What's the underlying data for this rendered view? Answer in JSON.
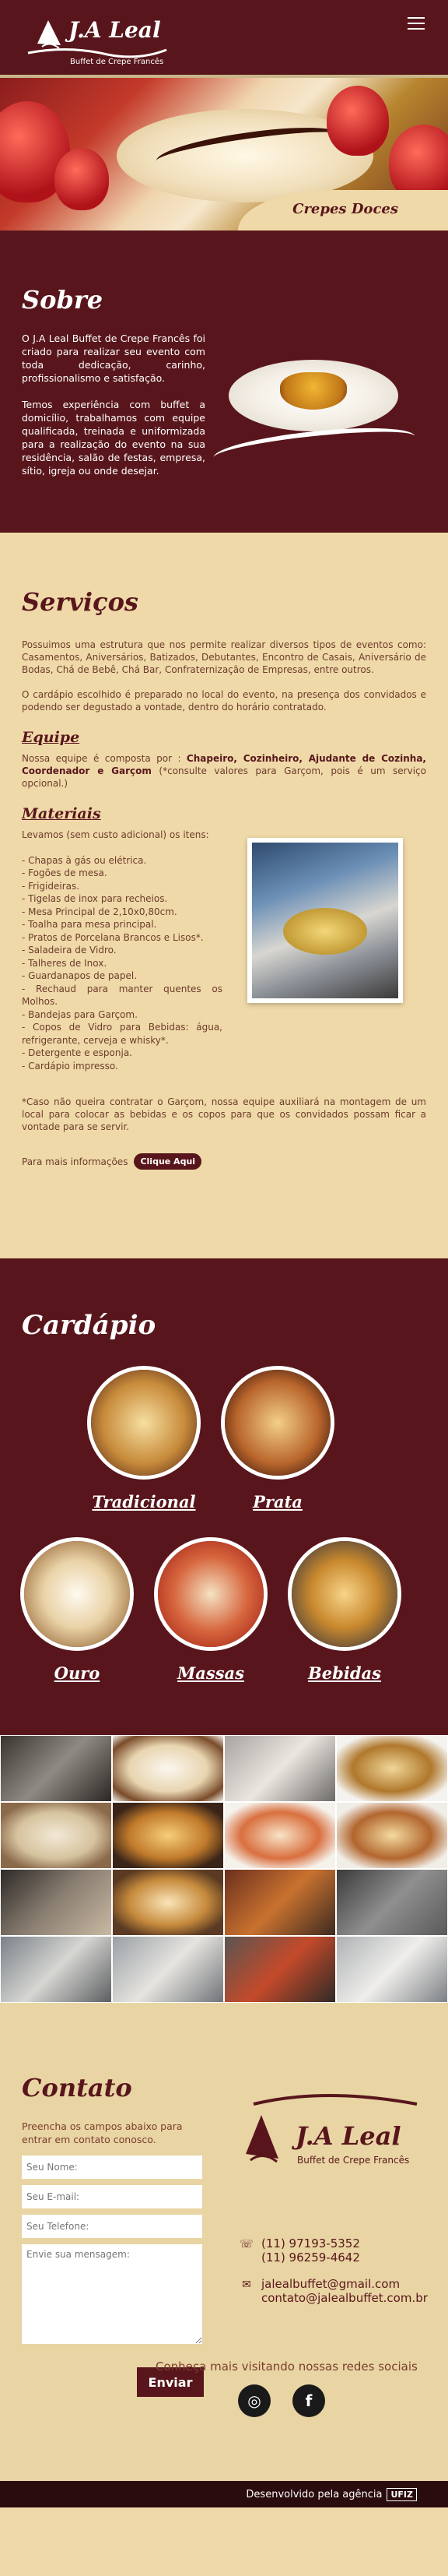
{
  "header": {
    "logo_title": "J.A Leal",
    "logo_subtitle": "Buffet de Crepe Francês"
  },
  "hero": {
    "caption": "Crepes Doces"
  },
  "sobre": {
    "title": "Sobre",
    "p1": "O J.A Leal Buffet de Crepe Francês foi criado para realizar seu evento com toda dedicação, carinho, profissionalismo e satisfação.",
    "p2": "Temos experiência com buffet a domicílio, trabalhamos com equipe qualificada, treinada e uniformizada para a realização do evento na sua residência, salão de festas, empresa, sítio, igreja ou onde desejar."
  },
  "servicos": {
    "title": "Serviços",
    "p1": "Possuimos uma estrutura que nos permite realizar diversos tipos de eventos como: Casamentos, Aniversários, Batizados, Debutantes, Encontro de Casais, Aniversário de Bodas, Chá de Bebê, Chá Bar, Confraternização de Empresas, entre outros.",
    "p2": "O cardápio escolhido é preparado no local do evento, na presença dos convidados e podendo ser degustado a vontade, dentro do horário contratado.",
    "equipe_title": "Equipe",
    "equipe_pre": "Nossa equipe é composta por :",
    "equipe_roles": "Chapeiro, Cozinheiro, Ajudante de Cozinha, Coordenador e Garçom",
    "equipe_note": "(*consulte valores para Garçom, pois é um serviço opcional.)",
    "materiais_title": "Materiais",
    "materiais_intro": "Levamos (sem custo adicional) os itens:",
    "materiais_items": [
      "- Chapas à gás ou elétrica.",
      "- Fogões de mesa.",
      "- Frigideiras.",
      "- Tigelas de inox para recheios.",
      "- Mesa Principal de 2,10x0,80cm.",
      "- Toalha para mesa principal.",
      "- Pratos de Porcelana Brancos e Lisos*.",
      "- Saladeira de Vidro.",
      "- Talheres de Inox.",
      "- Guardanapos de papel.",
      "- Rechaud para manter quentes os Molhos.",
      "- Bandejas para Garçom.",
      "- Copos de Vidro para Bebidas: água, refrigerante, cerveja e whisky*.",
      "- Detergente e esponja.",
      "- Cardápio impresso."
    ],
    "note": "*Caso não queira contratar o Garçom, nossa equipe auxiliará na montagem de um local para colocar as bebidas e os copos para que os convidados possam ficar a vontade para se servir.",
    "more_text": "Para mais informações",
    "more_button": "Clique Aqui"
  },
  "cardapio": {
    "title": "Cardápio",
    "items": [
      "Tradicional",
      "Prata",
      "Ouro",
      "Massas",
      "Bebidas"
    ]
  },
  "contato": {
    "title": "Contato",
    "lead": "Preencha os campos abaixo para entrar em contato conosco.",
    "name_placeholder": "Seu Nome:",
    "email_placeholder": "Seu E-mail:",
    "phone_placeholder": "Seu Telefone:",
    "message_placeholder": "Envie sua mensagem:",
    "send_button": "Enviar",
    "phone1": "(11) 97193-5352",
    "phone2": "(11) 96259-4642",
    "email1": "jalealbuffet@gmail.com",
    "email2": "contato@jalealbuffet.com.br",
    "social_text": "Conheça mais visitando nossas redes sociais"
  },
  "footer": {
    "credit": "Desenvolvido pela agência",
    "agency": "UFIZ"
  }
}
